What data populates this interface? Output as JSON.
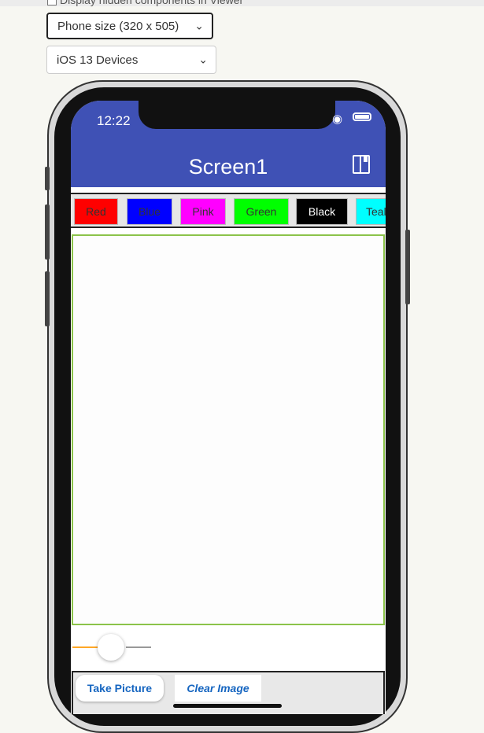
{
  "settings": {
    "hidden_components_label": "Display hidden components in Viewer",
    "size_select": "Phone size (320 x 505)",
    "device_select": "iOS 13 Devices"
  },
  "status_bar": {
    "time": "12:22"
  },
  "app": {
    "title": "Screen1",
    "color_buttons": [
      {
        "label": "Red",
        "bg": "#ff0000",
        "fg": "#333333"
      },
      {
        "label": "Blue",
        "bg": "#0000ff",
        "fg": "#333333"
      },
      {
        "label": "Pink",
        "bg": "#ff00ff",
        "fg": "#333333"
      },
      {
        "label": "Green",
        "bg": "#00ff00",
        "fg": "#333333"
      },
      {
        "label": "Black",
        "bg": "#000000",
        "fg": "#ffffff"
      },
      {
        "label": "Teal",
        "bg": "#00ffff",
        "fg": "#333333"
      }
    ],
    "take_picture_label": "Take Picture",
    "clear_image_label": "Clear Image"
  },
  "colors": {
    "app_bar": "#3f51b5",
    "canvas_border": "#8bc34a",
    "slider_active": "#ffa726",
    "button_text": "#1565c0"
  }
}
